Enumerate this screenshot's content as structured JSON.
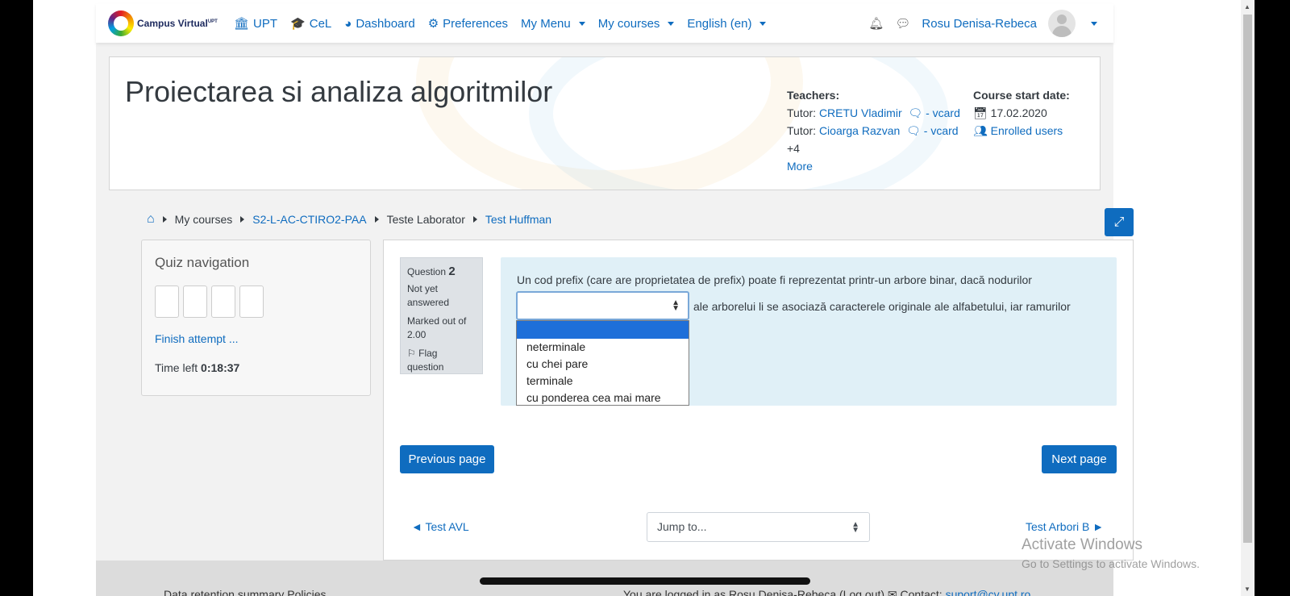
{
  "navbar": {
    "logo_text": "Campus Virtual",
    "logo_sup": "UPT",
    "items": [
      {
        "label": "UPT",
        "icon": "university-icon"
      },
      {
        "label": "CeL",
        "icon": "graduation-cap-icon"
      },
      {
        "label": "Dashboard",
        "icon": "tachometer-icon"
      },
      {
        "label": "Preferences",
        "icon": "cog-icon"
      },
      {
        "label": "My Menu",
        "icon": ""
      },
      {
        "label": "My courses",
        "icon": ""
      },
      {
        "label": "English (en)",
        "icon": ""
      }
    ],
    "user_name": "Rosu Denisa-Rebeca"
  },
  "course": {
    "title": "Proiectarea si analiza algoritmilor",
    "teachers_label": "Teachers:",
    "tutor_label": "Tutor:",
    "tutor1": "CRETU Vladimir",
    "tutor2": "Cioarga Razvan",
    "vcard": "- vcard",
    "more_count": "+4",
    "more_link": "More",
    "start_label": "Course start date:",
    "start_date": "17.02.2020",
    "enrolled": "Enrolled users"
  },
  "breadcrumb": [
    "My courses",
    "S2-L-AC-CTIRO2-PAA",
    "Teste Laborator",
    "Test Huffman"
  ],
  "quiz_nav": {
    "title": "Quiz navigation",
    "finish": "Finish attempt ...",
    "time_label": "Time left",
    "time_value": "0:18:37"
  },
  "question": {
    "label": "Question",
    "number": "2",
    "status": "Not yet answered",
    "marked": "Marked out of 2.00",
    "flag": "Flag question",
    "text1": "Un cod prefix (care are proprietatea de prefix) poate fi reprezentat printr-un arbore binar, dacă nodurilor",
    "text2": "ale arborelui li se asociază caracterele originale ale alfabetului, iar ramurilor",
    "options": [
      "",
      "neterminale",
      "cu chei pare",
      "terminale",
      "cu ponderea cea mai mare"
    ]
  },
  "buttons": {
    "prev": "Previous page",
    "next": "Next page"
  },
  "activity_nav": {
    "prev": "◄ Test AVL",
    "jump": "Jump to...",
    "next": "Test Arbori B ►"
  },
  "footer": {
    "left": "Data retention summary   Policies",
    "right_text": "You are logged in as Rosu Denisa-Rebeca (Log out) ✉ Contact: ",
    "right_link": "suport@cv.upt.ro"
  },
  "watermark": {
    "line1": "Activate Windows",
    "line2": "Go to Settings to activate Windows."
  }
}
